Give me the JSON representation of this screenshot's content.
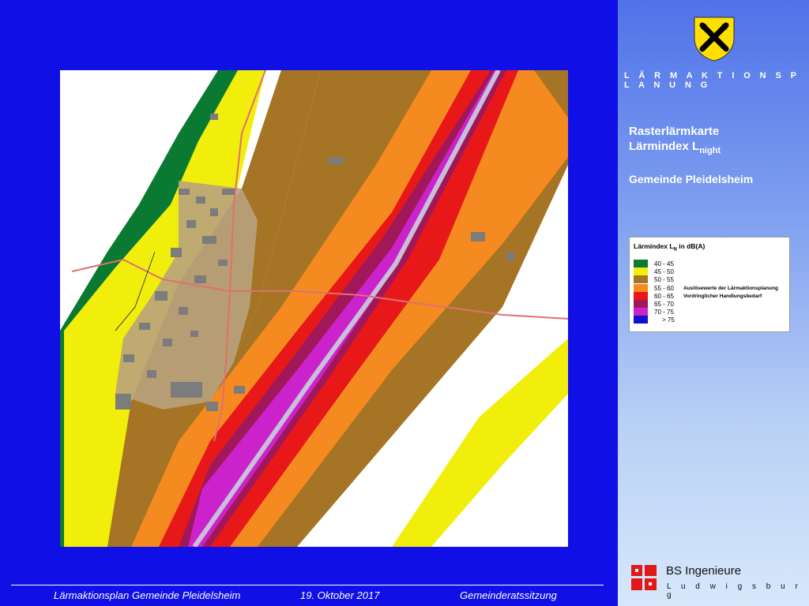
{
  "brand": "L Ä R M A K T I O N S P L A N U N G",
  "title": {
    "line1": "Rasterlärmkarte",
    "line2_main": "Lärmindex  L",
    "line2_sub": "night",
    "municipality": "Gemeinde Pleidelsheim"
  },
  "legend": {
    "title_main": "Lärmindex L",
    "title_sub": "N",
    "title_tail": " in dB(A)",
    "items": [
      {
        "range": "40 -  45",
        "color": "#0a7a32"
      },
      {
        "range": "45 -  50",
        "color": "#f2ee0c"
      },
      {
        "range": "50 -  55",
        "color": "#a57424"
      },
      {
        "range": "55 -  60",
        "color": "#f58a20"
      },
      {
        "range": "60 -  65",
        "color": "#e81818"
      },
      {
        "range": "65 -  70",
        "color": "#a0185a"
      },
      {
        "range": "70 -  75",
        "color": "#cc22cc"
      },
      {
        "range": "> 75",
        "color": "#1212cc"
      }
    ],
    "note1": "Auslösewerte der Lärmaktionsplanung",
    "note2": "Vordringlicher Handlungsbedarf"
  },
  "footer": {
    "plan": "Lärmaktionsplan Gemeinde Pleidelsheim",
    "date": "19. Oktober 2017",
    "meeting": "Gemeinderatssitzung"
  },
  "company": {
    "name": "BS Ingenieure",
    "city": "L u d w i g s b u r g"
  }
}
